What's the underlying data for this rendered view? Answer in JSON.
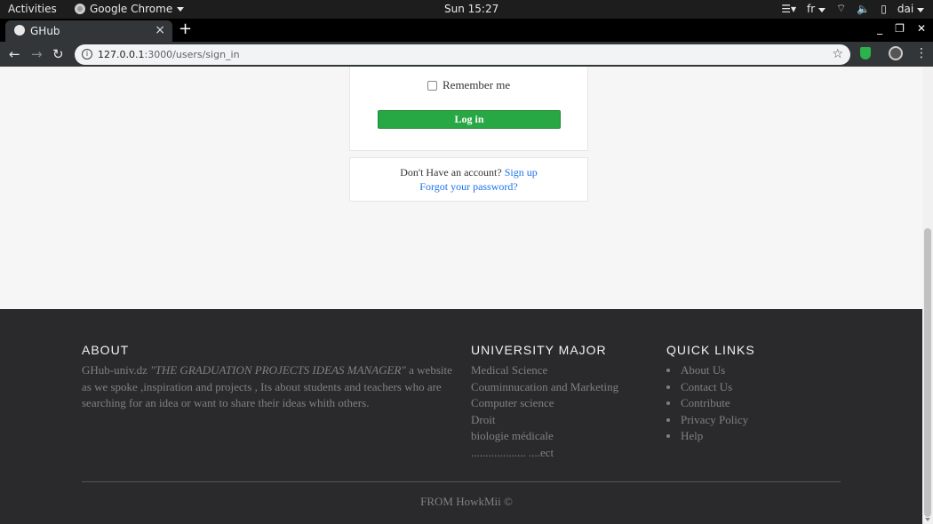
{
  "system_bar": {
    "activities": "Activities",
    "app_name": "Google Chrome",
    "clock": "Sun 15:27",
    "language": "fr",
    "user": "dai"
  },
  "browser": {
    "tab_title": "GHub",
    "url_host": "127.0.0.1",
    "url_path": ":3000/users/sign_in"
  },
  "login": {
    "remember_label": "Remember me",
    "login_button": "Log in",
    "no_account_text": "Don't Have an account?",
    "signup_link": "Sign up",
    "forgot_link": "Forgot your password?"
  },
  "footer": {
    "about_heading": "ABOUT",
    "about_site": "GHub-univ.dz",
    "about_tagline": "\"THE GRADUATION PROJECTS IDEAS MANAGER\"",
    "about_rest": " a website as we spoke ,inspiration and projects , Its about students and teachers who are searching for an idea or want to share their ideas whith others.",
    "major_heading": "UNIVERSITY MAJOR",
    "majors": [
      "Medical Science",
      "Couminnucation and Marketing",
      "Computer science",
      "Droit",
      "biologie médicale",
      "................... ....ect"
    ],
    "quick_heading": "QUICK LINKS",
    "quick_links": [
      "About Us",
      "Contact Us",
      "Contribute",
      "Privacy Policy",
      "Help"
    ],
    "copyright": "FROM HowkMii ©"
  }
}
